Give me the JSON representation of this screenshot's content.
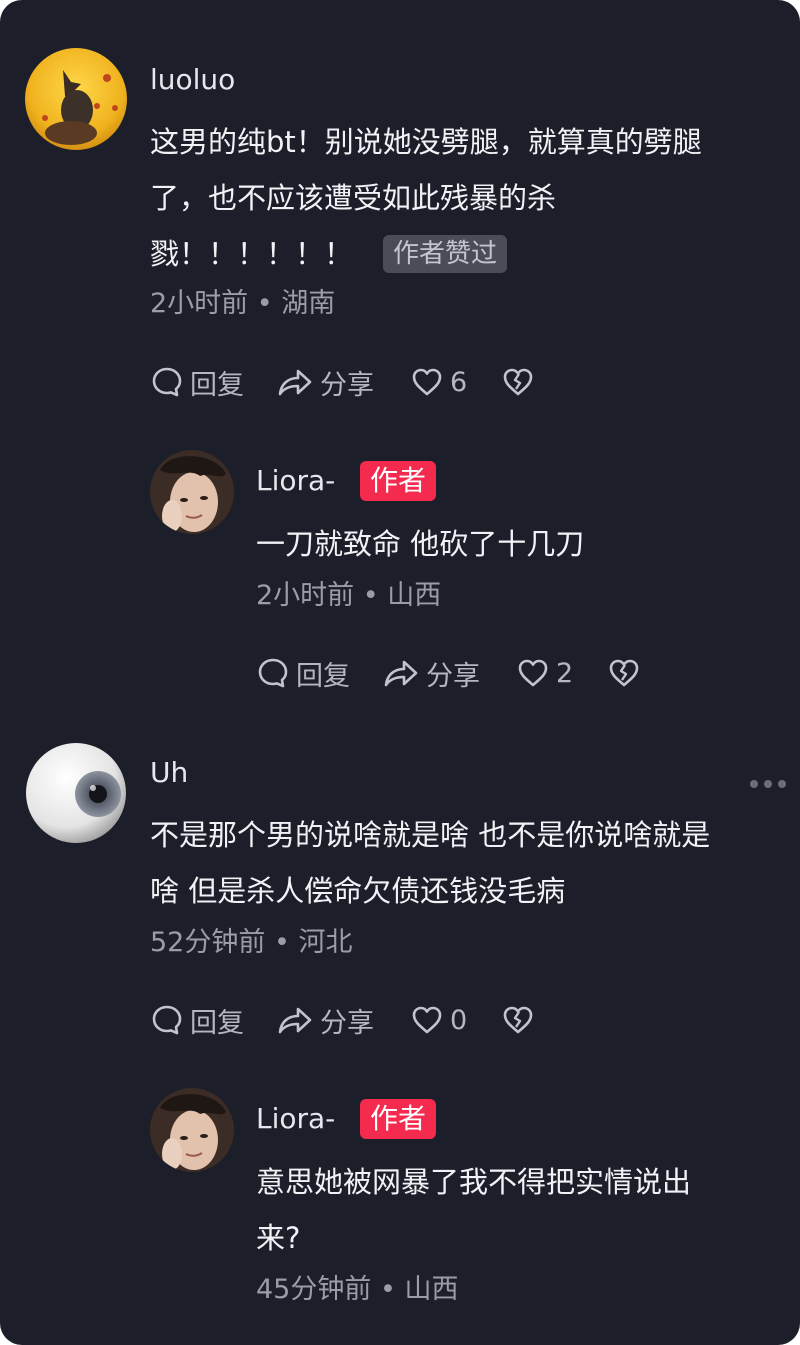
{
  "comments": [
    {
      "username": "luoluo",
      "text_lines": [
        "这男的纯bt！别说她没劈腿，就算真的劈腿",
        "了，也不应该遭受如此残暴的杀",
        "戮！！！！！！"
      ],
      "liked_badge": "作者赞过",
      "meta": "2小时前 • 湖南",
      "actions": {
        "reply": "回复",
        "share": "分享",
        "like_count": "6"
      }
    },
    {
      "username": "Liora-",
      "author_badge": "作者",
      "text_lines": [
        "一刀就致命 他砍了十几刀"
      ],
      "meta": "2小时前 • 山西",
      "actions": {
        "reply": "回复",
        "share": "分享",
        "like_count": "2"
      }
    },
    {
      "username": "Uh",
      "text_lines": [
        "不是那个男的说啥就是啥 也不是你说啥就是",
        "啥 但是杀人偿命欠债还钱没毛病"
      ],
      "meta": "52分钟前 • 河北",
      "actions": {
        "reply": "回复",
        "share": "分享",
        "like_count": "0"
      }
    },
    {
      "username": "Liora-",
      "author_badge": "作者",
      "text_lines": [
        "意思她被网暴了我不得把实情说出",
        "来?"
      ],
      "meta": "45分钟前 • 山西"
    }
  ],
  "icons": [
    "comment-bubble-icon",
    "share-arrow-icon",
    "heart-icon",
    "broken-heart-icon",
    "more-dots-icon"
  ],
  "colors": {
    "background": "#1c1e29",
    "author_badge": "#f52a4f",
    "liked_badge": "#4a4c57"
  }
}
